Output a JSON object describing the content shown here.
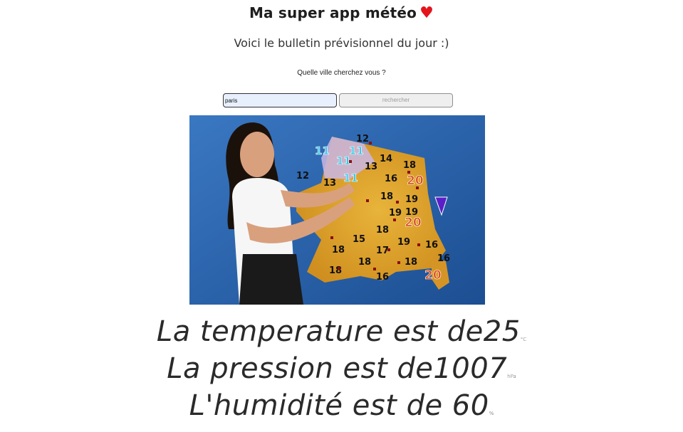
{
  "header": {
    "title": "Ma super app météo",
    "heart_icon": "heart-icon",
    "subtitle": "Voici le bulletin prévisionnel du jour :)"
  },
  "search": {
    "question": "Quelle ville cherchez vous ?",
    "value": "paris",
    "button_label": "rechercher"
  },
  "forecast_image": {
    "map_temperatures": [
      "12",
      "11",
      "11",
      "11",
      "14",
      "18",
      "12",
      "13",
      "11",
      "13",
      "16",
      "20",
      "18",
      "19",
      "19",
      "20",
      "18",
      "15",
      "15",
      "18",
      "17",
      "19",
      "16",
      "18",
      "18",
      "18",
      "16",
      "16",
      "20"
    ]
  },
  "stats": {
    "temperature_label": "La temperature est de",
    "temperature_value": "25",
    "temperature_unit": "°C",
    "pressure_label": "La pression est de",
    "pressure_value": "1007",
    "pressure_unit": "hPa",
    "humidity_label": "L'humidité est de ",
    "humidity_value": "60",
    "humidity_unit": "%"
  },
  "colors": {
    "heart": "#e5141b",
    "map_sea": "#2a62a8",
    "map_land": "#e3a82c",
    "cold_number": "#39c7e6",
    "hot_number": "#d9531e"
  }
}
